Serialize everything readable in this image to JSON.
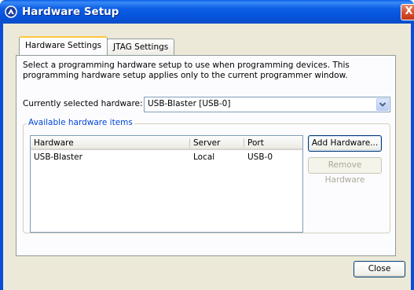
{
  "window": {
    "title": "Hardware Setup",
    "close_glyph": "X",
    "app_icon": "altera-app-icon"
  },
  "tabs": [
    {
      "label": "Hardware Settings",
      "active": true
    },
    {
      "label": "JTAG Settings",
      "active": false
    }
  ],
  "settings": {
    "description": "Select a programming hardware setup to use when programming devices. This programming hardware setup applies only to the current programmer window.",
    "current_label": "Currently selected hardware:",
    "current_value": "USB-Blaster [USB-0]"
  },
  "available": {
    "legend": "Available hardware items",
    "columns": [
      "Hardware",
      "Server",
      "Port"
    ],
    "rows": [
      {
        "hardware": "USB-Blaster",
        "server": "Local",
        "port": "USB-0"
      }
    ],
    "add_button": "Add Hardware...",
    "remove_button": "Remove Hardware"
  },
  "footer": {
    "close_button": "Close"
  },
  "colors": {
    "title_bar": "#0a5ee8",
    "dialog_bg": "#ece9d8",
    "legend_text": "#0046d5",
    "close_button": "#d2482a"
  }
}
